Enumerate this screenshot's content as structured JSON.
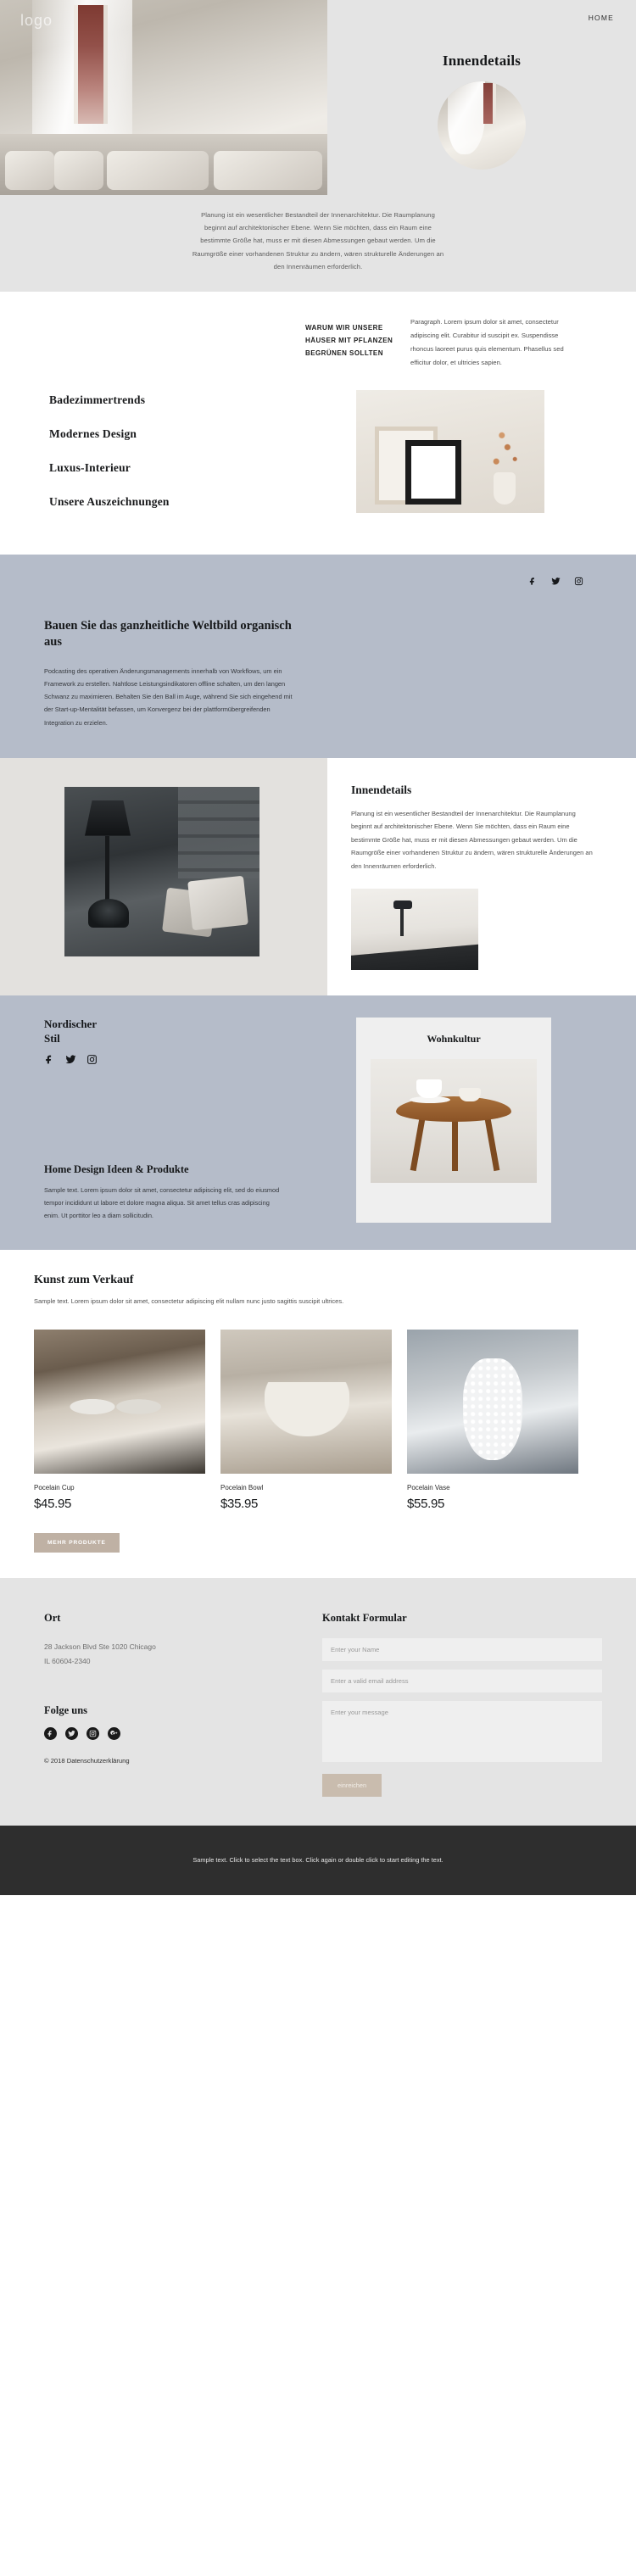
{
  "brand": {
    "logo": "logo"
  },
  "nav": {
    "items": [
      {
        "label": "HOME"
      }
    ]
  },
  "hero": {
    "title": "Innendetails",
    "paragraph": "Planung ist ein wesentlicher Bestandteil der Innenarchitektur. Die Raumplanung beginnt auf architektonischer Ebene. Wenn Sie möchten, dass ein Raum eine bestimmte Größe hat, muss er mit diesen Abmessungen gebaut werden. Um die Raumgröße einer vorhandenen Struktur zu ändern, wären strukturelle Änderungen an den Innenräumen erforderlich."
  },
  "section_features": {
    "kicker": "WARUM WIR UNSERE HÄUSER MIT PFLANZEN BEGRÜNEN SOLLTEN",
    "paragraph": "Paragraph. Lorem ipsum dolor sit amet, consectetur adipiscing elit. Curabitur id suscipit ex. Suspendisse rhoncus laoreet purus quis elementum. Phasellus sed efficitur dolor, et ultricies sapien.",
    "list": [
      {
        "label": "Badezimmertrends"
      },
      {
        "label": "Modernes Design"
      },
      {
        "label": "Luxus-Interieur"
      },
      {
        "label": "Unsere Auszeichnungen"
      }
    ]
  },
  "section_worldview": {
    "social": [
      {
        "name": "facebook"
      },
      {
        "name": "twitter"
      },
      {
        "name": "instagram"
      }
    ],
    "heading": "Bauen Sie das ganzheitliche Weltbild organisch aus",
    "paragraph": "Podcasting des operativen Änderungsmanagements innerhalb von Workflows, um ein Framework zu erstellen. Nahtlose Leistungsindikatoren offline schalten, um den langen Schwanz zu maximieren. Behalten Sie den Ball im Auge, während Sie sich eingehend mit der Start-up-Mentalität befassen, um Konvergenz bei der plattformübergreifenden Integration zu erzielen."
  },
  "section_details": {
    "heading": "Innendetails",
    "paragraph": "Planung ist ein wesentlicher Bestandteil der Innenarchitektur. Die Raumplanung beginnt auf architektonischer Ebene. Wenn Sie möchten, dass ein Raum eine bestimmte Größe hat, muss er mit diesen Abmessungen gebaut werden. Um die Raumgröße einer vorhandenen Struktur zu ändern, wären strukturelle Änderungen an den Innenräumen erforderlich."
  },
  "section_nordic": {
    "heading": "Nordischer Stil",
    "social": [
      {
        "name": "facebook"
      },
      {
        "name": "twitter"
      },
      {
        "name": "instagram"
      }
    ],
    "sub_heading": "Home Design Ideen & Produkte",
    "paragraph": "Sample text. Lorem ipsum dolor sit amet, consectetur adipiscing elit, sed do eiusmod tempor incididunt ut labore et dolore magna aliqua. Sit amet tellus cras adipiscing enim. Ut porttitor leo a diam sollicitudin.",
    "card_title": "Wohnkultur"
  },
  "section_products": {
    "heading": "Kunst zum Verkauf",
    "paragraph": "Sample text. Lorem ipsum dolor sit amet, consectetur adipiscing elit nullam nunc justo sagittis suscipit ultrices.",
    "items": [
      {
        "name": "Pocelain Cup",
        "price": "$45.95"
      },
      {
        "name": "Pocelain Bowl",
        "price": "$35.95"
      },
      {
        "name": "Pocelain Vase",
        "price": "$55.95"
      }
    ],
    "more_button": "MEHR PRODUKTE"
  },
  "footer": {
    "location_heading": "Ort",
    "address_line1": "28 Jackson Blvd Ste 1020 Chicago",
    "address_line2": "IL 60604-2340",
    "follow_heading": "Folge uns",
    "social": [
      {
        "name": "facebook"
      },
      {
        "name": "twitter"
      },
      {
        "name": "instagram"
      },
      {
        "name": "google-plus"
      }
    ],
    "copyright": "© 2018 Datenschutzerklärung",
    "form": {
      "heading": "Kontakt Formular",
      "name_placeholder": "Enter your Name",
      "email_placeholder": "Enter a valid email address",
      "message_placeholder": "Enter your message",
      "submit_label": "einreichen"
    }
  },
  "bottom_bar": {
    "text": "Sample text. Click to select the text box. Click again or double click to start editing the text."
  },
  "colors": {
    "accent": "#bfb1a4",
    "submit": "#c9bcae",
    "panel_blue": "#b5bcc9",
    "light_grey": "#e4e4e4",
    "dark_bar": "#2e2e2e"
  }
}
